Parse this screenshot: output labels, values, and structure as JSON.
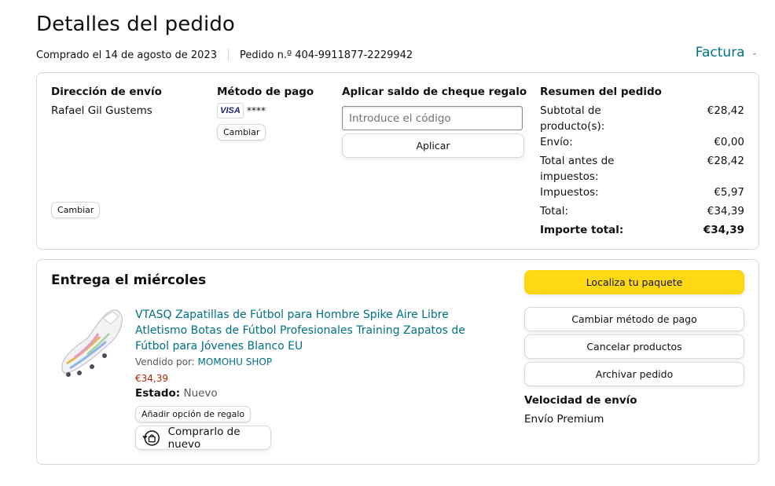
{
  "header": {
    "title": "Detalles del pedido",
    "purchased": "Comprado el 14 de agosto de 2023",
    "order_number": "Pedido n.º 404-9911877-2229942",
    "invoice_label": "Factura"
  },
  "shipping": {
    "title": "Dirección de envío",
    "name": "Rafael Gil Gustems",
    "change_label": "Cambiar"
  },
  "payment": {
    "title": "Método de pago",
    "card_brand": "VISA",
    "card_mask": "****",
    "change_label": "Cambiar"
  },
  "gift_card": {
    "title": "Aplicar saldo de cheque regalo",
    "placeholder": "Introduce el código",
    "apply_label": "Aplicar"
  },
  "summary": {
    "title": "Resumen del pedido",
    "rows": [
      {
        "label": "Subtotal de producto(s):",
        "value": "€28,42"
      },
      {
        "label": "Envío:",
        "value": "€0,00"
      },
      {
        "label": "Total antes de impuestos:",
        "value": "€28,42"
      },
      {
        "label": "Impuestos:",
        "value": "€5,97"
      },
      {
        "label": "Total:",
        "value": "€34,39"
      }
    ],
    "grand_total_label": "Importe total:",
    "grand_total_value": "€34,39"
  },
  "delivery": {
    "title": "Entrega el miércoles",
    "product_title": "VTASQ Zapatillas de Fútbol para Hombre Spike Aire Libre Atletismo Botas de Fútbol Profesionales Training Zapatos de Fútbol para Jóvenes Blanco EU",
    "sold_by_label": "Vendido por:",
    "seller": "MOMOHU SHOP",
    "price": "€34,39",
    "status_label": "Estado:",
    "status_value": "Nuevo",
    "gift_option_label": "Añadir opción de regalo",
    "buy_again_label": "Comprarlo de nuevo"
  },
  "actions": {
    "track": "Localiza tu paquete",
    "change_payment": "Cambiar método de pago",
    "cancel": "Cancelar productos",
    "archive": "Archivar pedido"
  },
  "shipping_speed": {
    "title": "Velocidad de envío",
    "value": "Envío Premium"
  },
  "colors": {
    "link": "#007185",
    "price": "#b12704",
    "primary_button": "#ffd814",
    "border": "#d5d9d9"
  }
}
